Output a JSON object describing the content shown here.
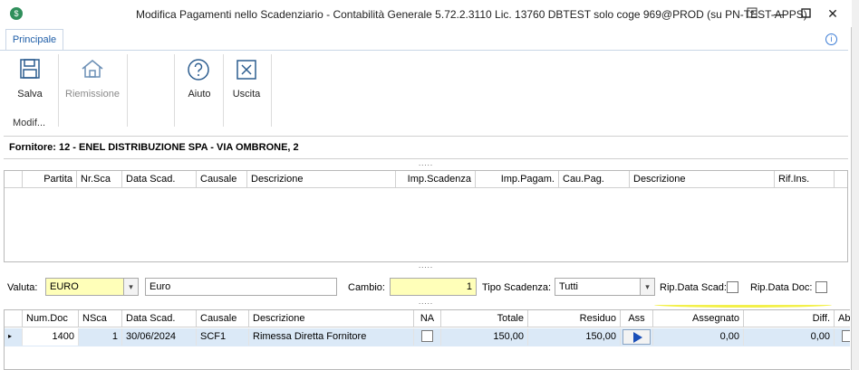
{
  "window": {
    "title": "Modifica Pagamenti nello Scadenziario - Contabilità Generale 5.72.2.3110 Lic. 13760 DBTEST solo coge 969@PROD (su PN-TEST-APPS)",
    "app_icon": "app-logo-icon",
    "controls": [
      "pin-icon",
      "minimize-icon",
      "maximize-icon",
      "close-icon"
    ]
  },
  "ribbon": {
    "tab_label": "Principale",
    "group_label": "Modif...",
    "buttons": [
      {
        "label": "Salva",
        "icon": "save-icon"
      },
      {
        "label": "Riemissione",
        "icon": "home-icon",
        "disabled": true
      },
      {
        "label": "Aiuto",
        "icon": "help-icon"
      },
      {
        "label": "Uscita",
        "icon": "close-box-icon"
      }
    ]
  },
  "supplier": {
    "text": "Fornitore: 12 - ENEL DISTRIBUZIONE SPA  - VIA OMBRONE, 2"
  },
  "splitter_dots": ".....",
  "top_grid": {
    "columns": [
      "Partita",
      "Nr.Sca",
      "Data Scad.",
      "Causale",
      "Descrizione",
      "Imp.Scadenza",
      "Imp.Pagam.",
      "Cau.Pag.",
      "Descrizione",
      "Rif.Ins."
    ]
  },
  "filters": {
    "valuta_label": "Valuta:",
    "valuta_value": "EURO",
    "valuta_desc": "Euro",
    "cambio_label": "Cambio:",
    "cambio_value": "1",
    "tipo_label": "Tipo Scadenza:",
    "tipo_value": "Tutti",
    "rip_data_scad_label": "Rip.Data Scad:",
    "rip_data_doc_label": "Rip.Data Doc:",
    "rip_data_scad_checked": false,
    "rip_data_doc_checked": false
  },
  "bottom_grid": {
    "columns": [
      "Num.Doc",
      "NSca",
      "Data Scad.",
      "Causale",
      "Descrizione",
      "NA",
      "Totale",
      "Residuo",
      "Ass",
      "Assegnato",
      "Diff.",
      "Abl"
    ],
    "rows": [
      {
        "num_doc": "1400",
        "nsca": "1",
        "data_scad": "30/06/2024",
        "causale": "SCF1",
        "descrizione": "Rimessa Diretta Fornitore",
        "na_checked": false,
        "totale": "150,00",
        "residuo": "150,00",
        "assegnato": "0,00",
        "diff": "0,00"
      }
    ]
  },
  "colors": {
    "accent": "#1f5ea8",
    "mandatory_field": "#ffffb9",
    "selected_row": "#dbe9f7",
    "highlight_marker": "#f3f04a"
  }
}
